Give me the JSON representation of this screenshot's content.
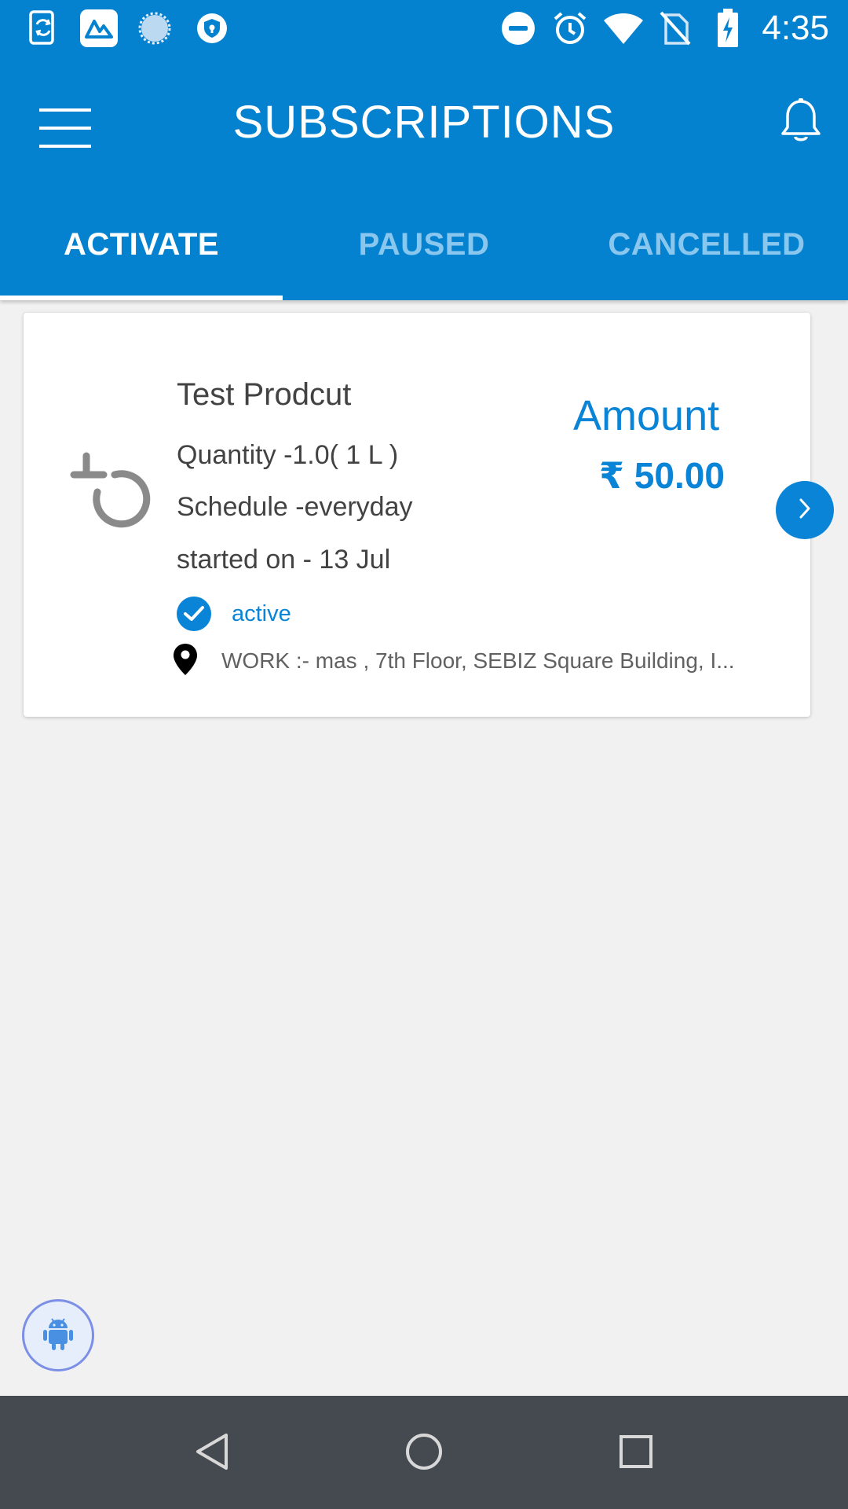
{
  "status_bar": {
    "time": "4:35",
    "left_icons": [
      "phone-sync-icon",
      "maps-app-icon",
      "loading-circle-icon",
      "vpn-shield-icon"
    ],
    "right_icons": [
      "do-not-disturb-icon",
      "alarm-icon",
      "wifi-icon",
      "no-sim-icon",
      "battery-charging-icon"
    ]
  },
  "app_bar": {
    "title": "SUBSCRIPTIONS",
    "menu_icon": "hamburger-menu-icon",
    "notification_icon": "bell-icon"
  },
  "tabs": [
    {
      "label": "ACTIVATE",
      "selected": true
    },
    {
      "label": "PAUSED",
      "selected": false
    },
    {
      "label": "CANCELLED",
      "selected": false
    }
  ],
  "subscription": {
    "product_name": "Test Prodcut",
    "quantity": "Quantity -1.0( 1 L )",
    "schedule": "Schedule -everyday",
    "started_on": "started on - 13 Jul",
    "status": "active",
    "address": "WORK :- mas , 7th Floor, SEBIZ Square Building, I...",
    "amount_label": "Amount",
    "amount_value": "₹ 50.00"
  },
  "colors": {
    "primary": "#0582cf",
    "accent": "#0a84d6",
    "tab_inactive": "#8ac7ef",
    "background": "#f1f1f1",
    "nav_bar": "#454a50"
  },
  "nav_bar": {
    "icons": [
      "back-icon",
      "home-icon",
      "recents-icon"
    ]
  }
}
